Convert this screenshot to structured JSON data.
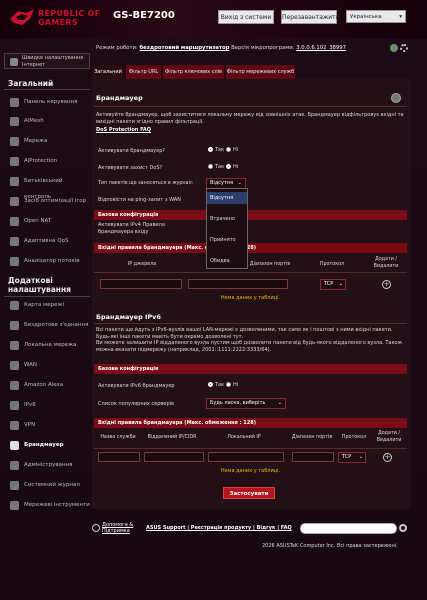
{
  "header": {
    "brand_line1": "REPUBLIC OF",
    "brand_line2": "GAMERS",
    "model": "GS-BE7200",
    "logout": "Вихід з системи",
    "reboot": "Перезавантажити",
    "language": "Українська"
  },
  "status": {
    "mode_label": "Режим роботи:",
    "mode_value": "бездротовий маршрутизатор",
    "fw_label": "Версія мікропрограми:",
    "fw_value": "3.0.0.6.102_38997"
  },
  "sidebar": {
    "quick_setup": "Швидке налаштування Інтернет",
    "section_general": "Загальний",
    "general_items": [
      "Панель керування",
      "AiMesh",
      "Мережа",
      "AiProtection",
      "Батьківський контроль",
      "Засіб оптимізації ігор",
      "Open NAT",
      "Адаптивна QoS",
      "Аналізатор потоків"
    ],
    "section_advanced": "Додаткові налаштування",
    "advanced_items": [
      "Карта мережі",
      "Бездротове з'єднання",
      "Локальна мережа",
      "WAN",
      "Amazon Alexa",
      "IPv6",
      "VPN",
      "Брандмауер",
      "Адміністрування",
      "Системний журнал",
      "Мережеві інструменти"
    ]
  },
  "tabs": [
    "Загальний",
    "Фільтр URL",
    "Фільтр ключових слів",
    "Фільтр мережевих служб"
  ],
  "firewall": {
    "title": "Брандмауер",
    "desc": "Активуйте брандмауер, щоб захиститися локальну мережу від зовнішніх атак. Брандмауер відфільтровує вхідні та вихідні пакети згідно правил фільтрації.",
    "link": "DoS Protection FAQ",
    "enable_label": "Активувати брандмауер?",
    "dos_label": "Активувати захист DoS?",
    "log_label": "Тип пакетів що заносяться в журнал:",
    "ping_label": "Відповісти на ping-запит з WAN",
    "yes": "Так",
    "no": "Ні",
    "log_value": "Відсутня",
    "log_options": [
      "Відсутня",
      "Втрачено",
      "Прийнято",
      "Обидва"
    ],
    "basic_config": "Базова конфігурація",
    "ipv4_inbound_label": "Активувати IPv4 Правила брандмауера вхіду",
    "ipv4_rules_bar": "Вхідні правила брандмауера (Макс. обмеження : 128)",
    "ipv4_cols": [
      "IP джерела",
      "Діапазон портів",
      "Протокол",
      "Додати / Видалити"
    ],
    "ipv4_proto": "TCP",
    "empty": "Нема даних у таблиці."
  },
  "ipv6": {
    "title": "Брандмауер IPv6",
    "desc1": "Всі пакети що йдуть з IPv6-вузлів вашої LAN-мережі є дозволеними, так само як і поштові з ними вхідні пакети. Будь-які інші пакети мають бути окремо дозволені тут.",
    "desc2": "Ви можете залишити IP віддаленого вузла пустим щоб дозволити пакети від будь-якого віддаленого вузла. Також можна вказати підмережу (наприклад, 2001::1111:2222:3333/64).",
    "basic_config": "Базова конфігурація",
    "enable_label": "Активувати IPv6 брандмауер",
    "services_label": "Список популярних серверів",
    "services_value": "Будь ласка, виберіть",
    "rules_bar": "Вхідні правила брандмауера (Макс. обмеження : 128)",
    "cols": [
      "Назва служби",
      "Віддалений IP/CIDR",
      "Локальний IP",
      "Діапазон портів",
      "Протокол",
      "Додати / Видалити"
    ],
    "proto": "TCP",
    "empty": "Нема даних у таблиці."
  },
  "apply": "Застосувати",
  "footer": {
    "help": "Допомога & Підтримка",
    "links": "ASUS Support | Реєстрація продукту | Відгук | FAQ",
    "copyright": "2026 ASUSTeK Computer Inc. Всі права застережені."
  },
  "colors": {
    "accent": "#c8102e",
    "bar": "#7a0c17",
    "empty_text": "#e0c000",
    "selected_option": "#2b3e6a"
  }
}
